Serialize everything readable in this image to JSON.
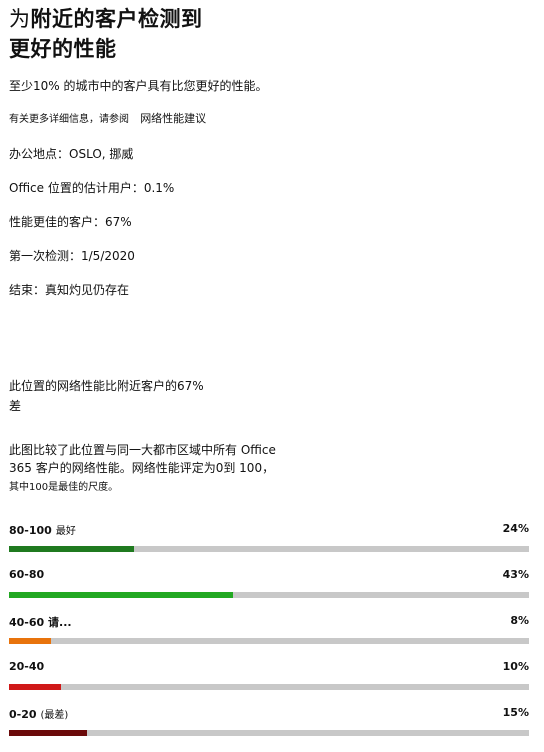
{
  "header": {
    "title_lead": "为",
    "title_rest": "附近的客户检测到",
    "title_line2": "更好的性能"
  },
  "summary": {
    "intro": "至少10% 的城市中的客户具有比您更好的性能。",
    "more_info": "有关更多详细信息，请参阅",
    "more_info_link": "网络性能建议",
    "office_location": "办公地点：OSLO, 挪威",
    "estimated_users": "Office 位置的估计用户：0.1%",
    "better_customers": "性能更佳的客户：67%",
    "first_detected": "第一次检测：1/5/2020",
    "end": "结束：真知灼见仍存在"
  },
  "comparison": {
    "headline_line1": "此位置的网络性能比附近客户的67%",
    "headline_line2": "差",
    "desc_line1": "此图比较了此位置与同一大都市区域中所有 Office",
    "desc_line2": "365 客户的网络性能。网络性能评定为0到 100，",
    "desc_line3": "其中100是最佳的尺度。"
  },
  "bars": [
    {
      "range": "80-100",
      "note": "最好",
      "percent_label": "24%",
      "fill_fraction": 0.24,
      "color": "#1f7a1f"
    },
    {
      "range": "60-80",
      "note": "",
      "percent_label": "43%",
      "fill_fraction": 0.43,
      "color": "#22a822"
    },
    {
      "range": "40-60 请...",
      "note": "",
      "percent_label": "8%",
      "fill_fraction": 0.08,
      "color": "#e8730c"
    },
    {
      "range": "20-40",
      "note": "",
      "percent_label": "10%",
      "fill_fraction": 0.1,
      "color": "#d01818"
    },
    {
      "range": "0-20",
      "note": "(最差)",
      "percent_label": "15%",
      "fill_fraction": 0.15,
      "color": "#6b0a0a"
    }
  ]
}
